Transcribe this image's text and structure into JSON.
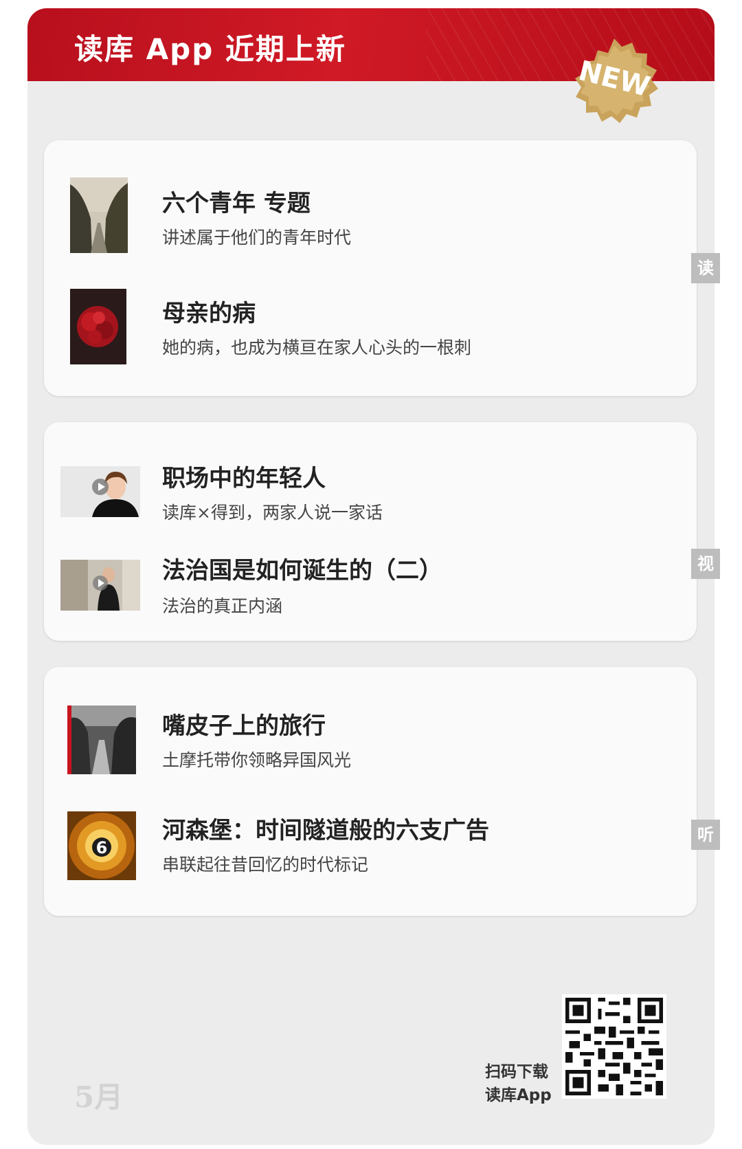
{
  "header": {
    "title": "读库 App 近期上新",
    "badge": "NEW"
  },
  "sections": [
    {
      "tab": "读",
      "items": [
        {
          "title": "六个青年 专题",
          "subtitle": "讲述属于他们的青年时代",
          "image": "tree-lined-road-photo"
        },
        {
          "title": "母亲的病",
          "subtitle": "她的病，也成为横亘在家人心头的一根刺",
          "image": "red-peony-photo"
        }
      ]
    },
    {
      "tab": "视",
      "items": [
        {
          "title": "职场中的年轻人",
          "subtitle": "读库×得到，两家人说一家话",
          "image": "video-thumbnail-woman"
        },
        {
          "title": "法治国是如何诞生的（二）",
          "subtitle": "法治的真正内涵",
          "image": "video-thumbnail-man"
        }
      ]
    },
    {
      "tab": "听",
      "items": [
        {
          "title": "嘴皮子上的旅行",
          "subtitle": "土摩托带你领略异国风光",
          "image": "jungle-river-photo"
        },
        {
          "title": "河森堡：时间隧道般的六支广告",
          "subtitle": "串联起往昔回忆的时代标记",
          "image": "number-six-tunnel-image"
        }
      ]
    }
  ],
  "footer": {
    "month": "5月",
    "scan_line1": "扫码下载",
    "scan_line2": "读库App",
    "qr_icon": "qr-code-icon"
  },
  "colors": {
    "header_red": "#c8141f",
    "badge_gold": "#c8a15a",
    "tab_gray": "#bdbdbd"
  }
}
